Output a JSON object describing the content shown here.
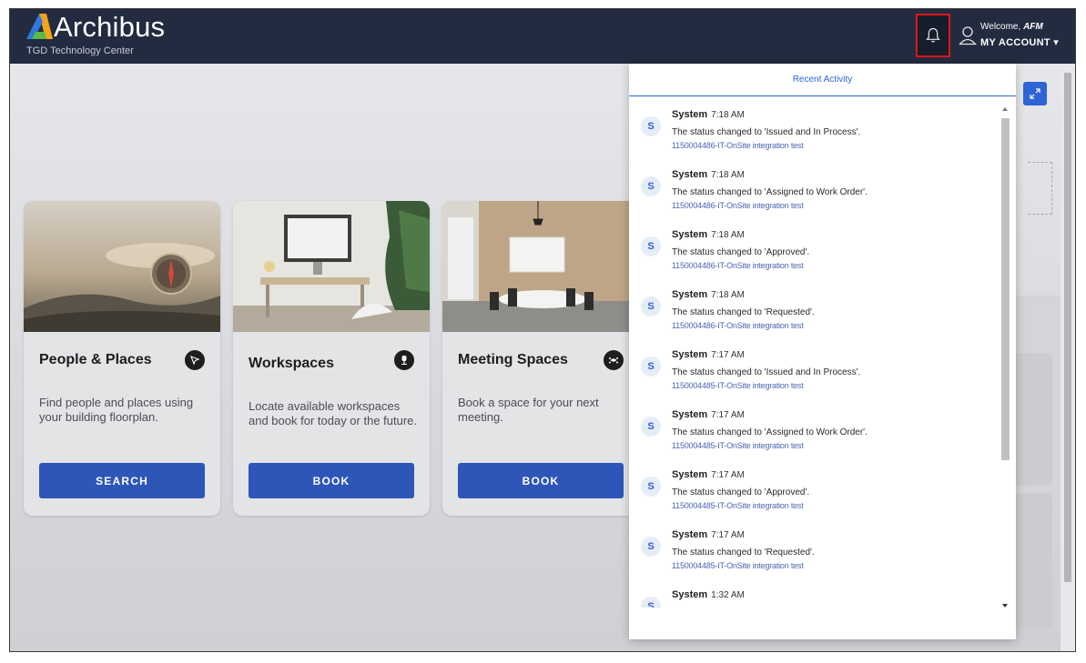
{
  "header": {
    "brand": "Archibus",
    "site": "TGD Technology Center",
    "welcome_prefix": "Welcome, ",
    "welcome_user": "AFM",
    "account_label": "MY ACCOUNT ▾",
    "notifications_icon": "bell-icon",
    "user_icon": "user-icon"
  },
  "colors": {
    "header_bg": "#222b40",
    "accent": "#2e56b8",
    "highlight_border": "#e01616"
  },
  "cards": [
    {
      "title": "People & Places",
      "icon": "location-arrow-icon",
      "description": "Find people and places using your building floorplan.",
      "button": "SEARCH"
    },
    {
      "title": "Workspaces",
      "icon": "office-chair-icon",
      "description": "Locate available workspaces and book for today or the future.",
      "button": "BOOK"
    },
    {
      "title": "Meeting Spaces",
      "icon": "meeting-table-icon",
      "description": "Book a space for your next meeting.",
      "button": "BOOK"
    }
  ],
  "recent_activity": {
    "title": "Recent Activity",
    "items": [
      {
        "initial": "S",
        "who": "System",
        "time": "7:18 AM",
        "message": "The status changed to 'Issued and In Process'.",
        "link": "1150004486-IT-OnSite integration test"
      },
      {
        "initial": "S",
        "who": "System",
        "time": "7:18 AM",
        "message": "The status changed to 'Assigned to Work Order'.",
        "link": "1150004486-IT-OnSite integration test"
      },
      {
        "initial": "S",
        "who": "System",
        "time": "7:18 AM",
        "message": "The status changed to 'Approved'.",
        "link": "1150004486-IT-OnSite integration test"
      },
      {
        "initial": "S",
        "who": "System",
        "time": "7:18 AM",
        "message": "The status changed to 'Requested'.",
        "link": "1150004486-IT-OnSite integration test"
      },
      {
        "initial": "S",
        "who": "System",
        "time": "7:17 AM",
        "message": "The status changed to 'Issued and In Process'.",
        "link": "1150004485-IT-OnSite integration test"
      },
      {
        "initial": "S",
        "who": "System",
        "time": "7:17 AM",
        "message": "The status changed to 'Assigned to Work Order'.",
        "link": "1150004485-IT-OnSite integration test"
      },
      {
        "initial": "S",
        "who": "System",
        "time": "7:17 AM",
        "message": "The status changed to 'Approved'.",
        "link": "1150004485-IT-OnSite integration test"
      },
      {
        "initial": "S",
        "who": "System",
        "time": "7:17 AM",
        "message": "The status changed to 'Requested'.",
        "link": "1150004485-IT-OnSite integration test"
      },
      {
        "initial": "S",
        "who": "System",
        "time": "1:32 AM",
        "message": "",
        "link": ""
      }
    ]
  }
}
